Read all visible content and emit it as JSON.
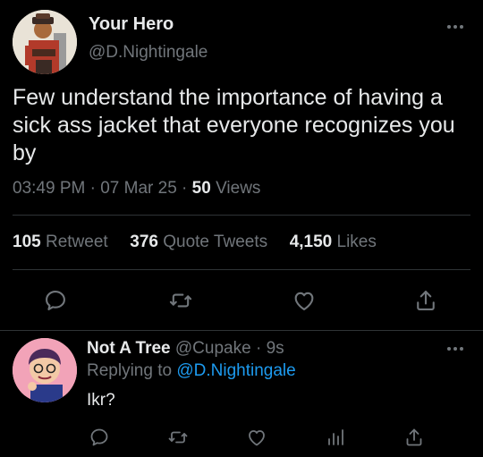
{
  "main_tweet": {
    "author": {
      "name": "Your Hero",
      "handle": "@D.Nightingale"
    },
    "text": "Few understand the importance of having a sick ass jacket that everyone recognizes you by",
    "time": "03:49 PM",
    "date": "07 Mar 25",
    "views_count": "50",
    "views_label": "Views",
    "stats": {
      "retweets": {
        "count": "105",
        "label": "Retweet"
      },
      "quotes": {
        "count": "376",
        "label": "Quote Tweets"
      },
      "likes": {
        "count": "4,150",
        "label": "Likes"
      }
    },
    "actions": [
      "reply-icon",
      "retweet-icon",
      "like-icon",
      "share-icon"
    ]
  },
  "reply_tweet": {
    "author": {
      "name": "Not A Tree",
      "handle": "@Cupake"
    },
    "age": "9s",
    "replying_label": "Replying to",
    "replying_handle": "@D.Nightingale",
    "text": "Ikr?",
    "actions": [
      "reply-icon",
      "retweet-icon",
      "like-icon",
      "views-icon",
      "share-icon"
    ]
  },
  "colors": {
    "background": "#000000",
    "text_primary": "#e7e9ea",
    "text_secondary": "#71767b",
    "link": "#1d9bf0",
    "divider": "#2f3336"
  }
}
